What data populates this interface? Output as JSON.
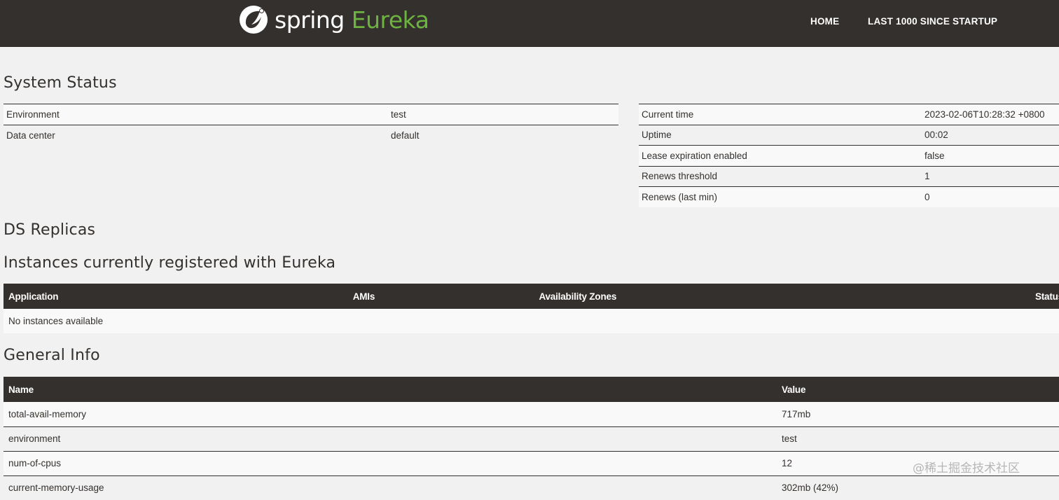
{
  "brand": {
    "word1": "spring",
    "word2": "Eureka"
  },
  "nav": {
    "home": "HOME",
    "last1000": "LAST 1000 SINCE STARTUP"
  },
  "headings": {
    "system_status": "System Status",
    "ds_replicas": "DS Replicas",
    "instances": "Instances currently registered with Eureka",
    "general_info": "General Info"
  },
  "system_left": [
    {
      "label": "Environment",
      "value": "test"
    },
    {
      "label": "Data center",
      "value": "default"
    }
  ],
  "system_right": [
    {
      "label": "Current time",
      "value": "2023-02-06T10:28:32 +0800"
    },
    {
      "label": "Uptime",
      "value": "00:02"
    },
    {
      "label": "Lease expiration enabled",
      "value": "false"
    },
    {
      "label": "Renews threshold",
      "value": "1"
    },
    {
      "label": "Renews (last min)",
      "value": "0"
    }
  ],
  "instances": {
    "columns": [
      "Application",
      "AMIs",
      "Availability Zones",
      "Status"
    ],
    "empty_message": "No instances available"
  },
  "general_info": {
    "columns": [
      "Name",
      "Value"
    ],
    "rows": [
      {
        "name": "total-avail-memory",
        "value": "717mb"
      },
      {
        "name": "environment",
        "value": "test"
      },
      {
        "name": "num-of-cpus",
        "value": "12"
      },
      {
        "name": "current-memory-usage",
        "value": "302mb (42%)"
      }
    ]
  },
  "watermark": "@稀土掘金技术社区",
  "colors": {
    "header_bg": "#34302d",
    "brand_green": "#6db33f",
    "page_bg": "#f1f1f1"
  }
}
